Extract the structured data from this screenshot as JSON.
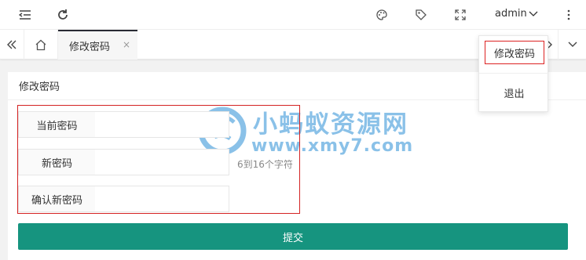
{
  "header": {
    "user": "admin",
    "icons": [
      "menu-fold-icon",
      "refresh-icon",
      "palette-icon",
      "tag-icon",
      "fullscreen-icon",
      "more-vertical-icon"
    ]
  },
  "tabs": {
    "active_label": "修改密码",
    "close_glyph": "×"
  },
  "dropdown_menu": {
    "items": [
      {
        "label": "修改密码"
      },
      {
        "label": "退出"
      }
    ]
  },
  "card": {
    "title": "修改密码"
  },
  "form": {
    "fields": [
      {
        "label": "当前密码",
        "value": ""
      },
      {
        "label": "新密码",
        "value": ""
      },
      {
        "label": "确认新密码",
        "value": ""
      }
    ],
    "new_password_hint": "6到16个字符",
    "submit_label": "提交"
  },
  "watermark": {
    "title": "小蚂蚁资源网",
    "url": "www.xmy7.com"
  },
  "colors": {
    "primary": "#16947f",
    "highlight_border": "#d42222",
    "watermark": "#2c8fd6"
  }
}
